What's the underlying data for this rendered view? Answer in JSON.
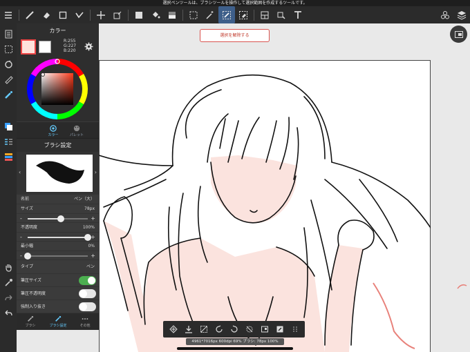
{
  "status": {
    "message": "選択ペンツールは、ブラシツールを操作して選択範囲を作成するツールです。"
  },
  "canvas": {
    "deselect_label": "選択を解除する"
  },
  "color_panel": {
    "title": "カラー",
    "rgb": {
      "r": "R:255",
      "g": "G:227",
      "b": "B:220"
    },
    "main_color": "#ffe3dc",
    "tabs": [
      "カラー",
      "パレット"
    ]
  },
  "brush_panel": {
    "title": "ブラシ設定",
    "name_label": "名前",
    "name_value": "ペン（大）",
    "size_label": "サイズ",
    "size_value": "78px",
    "size_level": 0.55,
    "opacity_label": "不透明度",
    "opacity_value": "100%",
    "opacity_level": 1.0,
    "min_width_label": "最小幅",
    "min_width_value": "0%",
    "min_width_level": 0.0,
    "type_label": "タイプ",
    "type_value": "ペン",
    "toggles": [
      {
        "label": "筆圧サイズ",
        "on": true
      },
      {
        "label": "筆圧不透明度",
        "on": false
      },
      {
        "label": "強制入り抜き",
        "on": false
      }
    ],
    "bottom_tabs": [
      "ブラシ",
      "ブラシ設定",
      "その他"
    ]
  },
  "info": {
    "text": "4961*7016px 600dpi 69% ブラシ: 78px 100%"
  },
  "colors": {
    "accent": "#4caf50",
    "selection": "#d9534f",
    "toolbar": "#2b2b2b"
  }
}
